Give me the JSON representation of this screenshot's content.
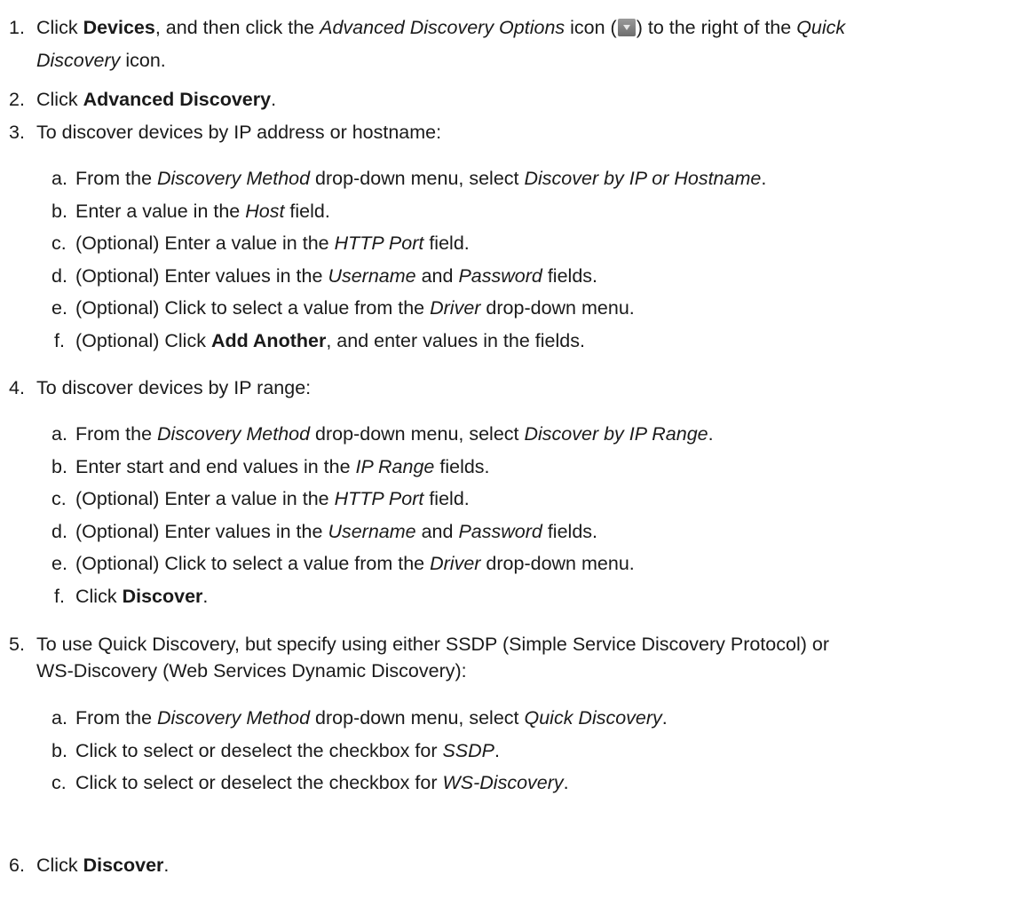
{
  "steps": [
    {
      "num": "1.",
      "line1": {
        "a": "Click ",
        "b": "Devices",
        "c": ", and then click the ",
        "d": "Advanced Discovery Options",
        "e": " icon (",
        "f": ") to the right of the ",
        "g": "Quick"
      },
      "line2": {
        "a": "Discovery",
        "b": " icon."
      },
      "icon": "dropdown-arrow-icon"
    },
    {
      "num": "2.",
      "line1": {
        "a": "Click ",
        "b": "Advanced Discovery",
        "c": "."
      }
    },
    {
      "num": "3.",
      "line1": {
        "a": "To discover devices by IP address or hostname:"
      },
      "subs": [
        {
          "ltr": "a.",
          "a": "From the ",
          "b": "Discovery Method",
          "c": " drop-down menu, select ",
          "d": "Discover by IP or Hostname",
          "e": "."
        },
        {
          "ltr": "b.",
          "a": "Enter a value in the ",
          "b": "Host",
          "c": " field."
        },
        {
          "ltr": "c.",
          "a": "(Optional) Enter a value in the ",
          "b": "HTTP Port",
          "c": " field."
        },
        {
          "ltr": "d.",
          "a": "(Optional) Enter values in the ",
          "b": "Username",
          "c": " and ",
          "d": "Password",
          "e": " fields."
        },
        {
          "ltr": "e.",
          "a": "(Optional) Click to select a value from the ",
          "b": "Driver",
          "c": " drop-down menu."
        },
        {
          "ltr": "f.",
          "a": "(Optional) Click ",
          "b": "Add Another",
          "c": ", and enter values in the fields."
        }
      ]
    },
    {
      "num": "4.",
      "line1": {
        "a": "To discover devices by IP range:"
      },
      "subs": [
        {
          "ltr": "a.",
          "a": "From the ",
          "b": "Discovery Method",
          "c": " drop-down menu, select ",
          "d": "Discover by IP Range",
          "e": "."
        },
        {
          "ltr": "b.",
          "a": "Enter start and end values in the ",
          "b": "IP Range",
          "c": " fields."
        },
        {
          "ltr": "c.",
          "a": "(Optional) Enter a value in the ",
          "b": "HTTP Port",
          "c": " field."
        },
        {
          "ltr": "d.",
          "a": "(Optional) Enter values in the ",
          "b": "Username",
          "c": " and ",
          "d": "Password",
          "e": " fields."
        },
        {
          "ltr": "e.",
          "a": "(Optional) Click to select a value from the ",
          "b": "Driver",
          "c": " drop-down menu."
        },
        {
          "ltr": "f.",
          "a": "Click ",
          "b": "Discover",
          "c": "."
        }
      ]
    },
    {
      "num": "5.",
      "line1": {
        "a": "To use Quick Discovery, but specify using either SSDP (Simple Service Discovery Protocol) or"
      },
      "line2": {
        "a": "WS-Discovery (Web Services Dynamic Discovery):"
      },
      "subs": [
        {
          "ltr": "a.",
          "a": "From the ",
          "b": "Discovery Method",
          "c": " drop-down menu, select ",
          "d": "Quick Discovery",
          "e": "."
        },
        {
          "ltr": "b.",
          "a": "Click to select or deselect the checkbox for ",
          "b": "SSDP",
          "c": "."
        },
        {
          "ltr": "c.",
          "a": "Click to select or deselect the checkbox for ",
          "b": "WS-Discovery",
          "c": "."
        }
      ]
    },
    {
      "num": "6.",
      "line1": {
        "a": "Click ",
        "b": "Discover",
        "c": "."
      }
    }
  ]
}
